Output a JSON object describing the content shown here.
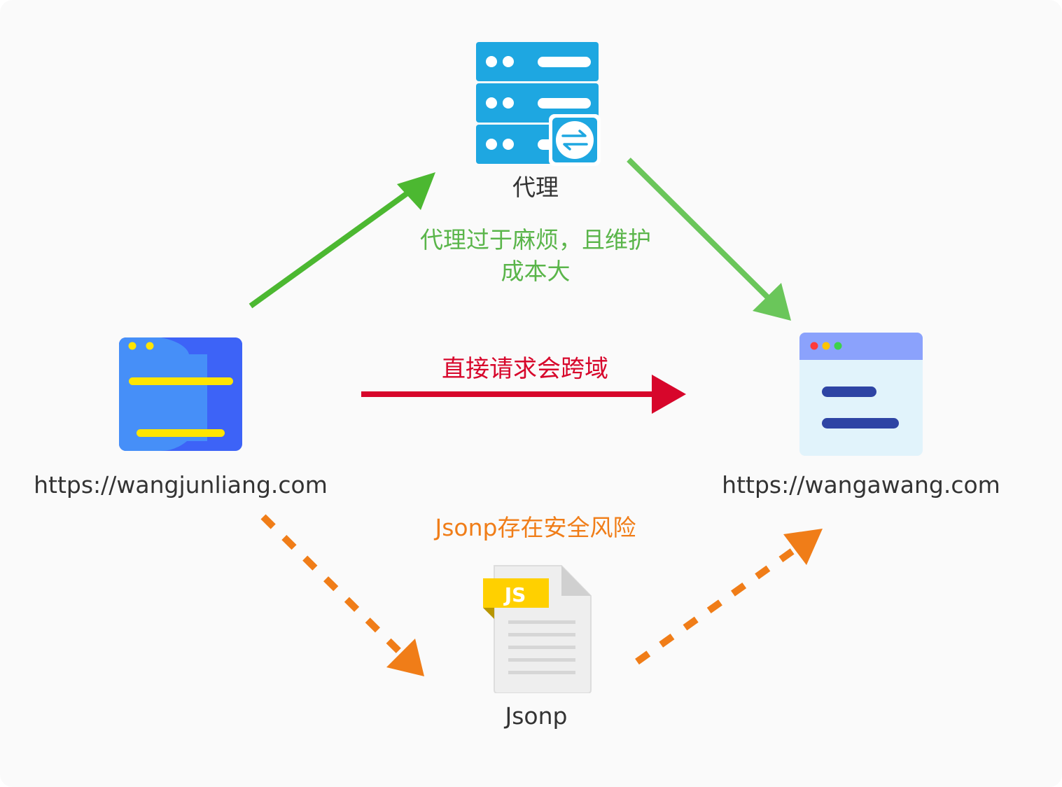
{
  "nodes": {
    "proxy": {
      "label": "代理",
      "icon": "server-exchange-icon"
    },
    "source": {
      "label": "https://wangjunliang.com",
      "icon": "browser-window-icon"
    },
    "target": {
      "label": "https://wangawang.com",
      "icon": "browser-window-icon"
    },
    "jsonp": {
      "label": "Jsonp",
      "icon": "js-file-icon",
      "badge": "JS"
    }
  },
  "notes": {
    "proxy": "代理过于麻烦，且维护成本大",
    "direct": "直接请求会跨域",
    "jsonp": "Jsonp存在安全风险"
  },
  "colors": {
    "proxy_arrow": "#4cb831",
    "proxy_arrow_light": "#6ac65a",
    "direct_arrow": "#d7062b",
    "jsonp_arrow": "#f07d18",
    "server": "#1ea7e1",
    "source_window": "#3d63f7",
    "target_window": "#e1f3fb"
  }
}
